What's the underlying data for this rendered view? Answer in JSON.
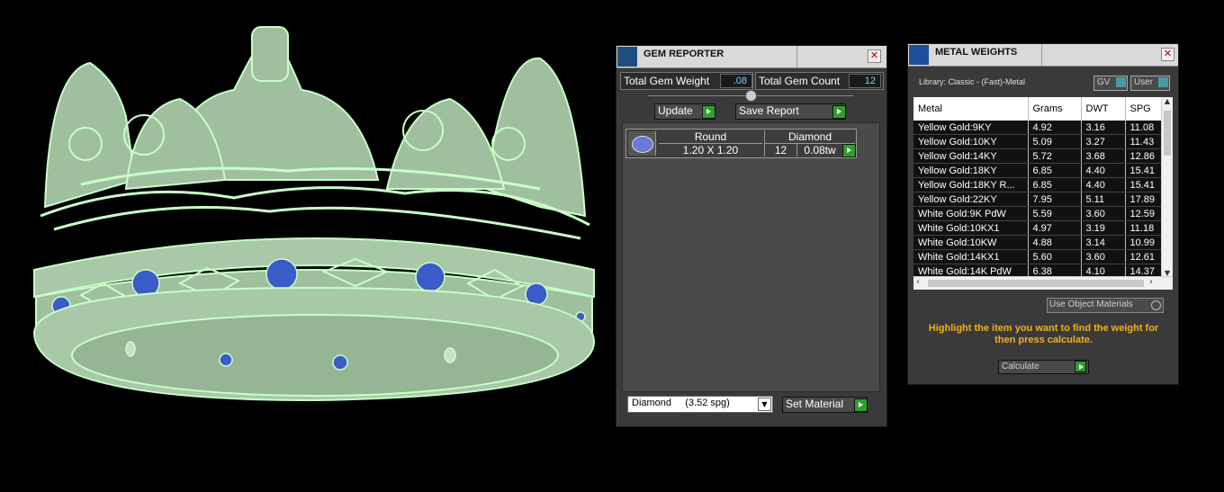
{
  "gem_reporter": {
    "title": "GEM REPORTER",
    "total_weight_label": "Total Gem Weight",
    "total_weight_value": ".08",
    "total_count_label": "Total Gem Count",
    "total_count_value": "12",
    "update_label": "Update",
    "save_report_label": "Save Report",
    "table_headers": [
      "Round",
      "Diamond"
    ],
    "row": {
      "size": "1.20 X 1.20",
      "count": "12",
      "weight": "0.08tw"
    },
    "material_select": "Diamond     (3.52 spg)",
    "set_material_label": "Set Material"
  },
  "metal_weights": {
    "title": "METAL WEIGHTS",
    "library": "Library: Classic - (Fast)-Metal",
    "gv_label": "GV",
    "user_label": "User",
    "columns": [
      "Metal",
      "Grams",
      "DWT",
      "SPG"
    ],
    "rows": [
      [
        "Yellow Gold:9KY",
        "4.92",
        "3.16",
        "11.08"
      ],
      [
        "Yellow Gold:10KY",
        "5.09",
        "3.27",
        "11.43"
      ],
      [
        "Yellow Gold:14KY",
        "5.72",
        "3.68",
        "12.86"
      ],
      [
        "Yellow Gold:18KY",
        "6.85",
        "4.40",
        "15.41"
      ],
      [
        "Yellow Gold:18KY R...",
        "6.85",
        "4.40",
        "15.41"
      ],
      [
        "Yellow Gold:22KY",
        "7.95",
        "5.11",
        "17.89"
      ],
      [
        "White Gold:9K PdW",
        "5.59",
        "3.60",
        "12.59"
      ],
      [
        "White Gold:10KX1",
        "4.97",
        "3.19",
        "11.18"
      ],
      [
        "White Gold:10KW",
        "4.88",
        "3.14",
        "10.99"
      ],
      [
        "White Gold:14KX1",
        "5.60",
        "3.60",
        "12.61"
      ],
      [
        "White Gold:14K PdW",
        "6.38",
        "4.10",
        "14.37"
      ]
    ],
    "use_object_materials": "Use Object Materials",
    "hint": "Highlight the item you want to find the weight for then press calculate.",
    "calculate_label": "Calculate"
  },
  "colors": {
    "model_fill": "#a8c8a8",
    "model_edge": "#c8ffc8",
    "gem": "#3a5cc8",
    "hint_text": "#f0b020",
    "button_green": "#2e9e2e"
  }
}
